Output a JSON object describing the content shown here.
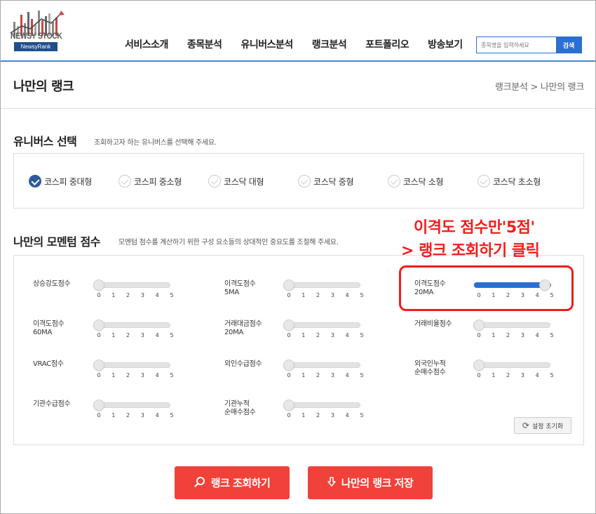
{
  "header": {
    "logo_text": "NEWSY STOCK",
    "logo_badge": "NewsyRank",
    "nav": [
      "서비스소개",
      "종목분석",
      "유니버스분석",
      "랭크분석",
      "포트폴리오",
      "방송보기"
    ],
    "search_placeholder": "종목명을 입력하세요",
    "search_button": "검색"
  },
  "page": {
    "title": "나만의 랭크",
    "breadcrumb": "랭크분석 > 나만의 랭크"
  },
  "universe": {
    "title": "유니버스 선택",
    "description": "조회하고자 하는 유니버스를 선택해 주세요.",
    "options": [
      {
        "label": "코스피 중대형",
        "checked": true
      },
      {
        "label": "코스피 중소형",
        "checked": false
      },
      {
        "label": "코스닥 대형",
        "checked": false
      },
      {
        "label": "코스닥 중형",
        "checked": false
      },
      {
        "label": "코스닥 소형",
        "checked": false
      },
      {
        "label": "코스닥 초소형",
        "checked": false
      }
    ]
  },
  "momentum": {
    "title": "나만의 모멘텀 점수",
    "description": "모멘텀 점수를 계산하기 위한 구성 요소들의 상대적인 중요도를 조절해 주세요.",
    "tick_labels": [
      "0",
      "1",
      "2",
      "3",
      "4",
      "5"
    ],
    "sliders": [
      {
        "label_lines": [
          "상승강도점수"
        ],
        "value": 0
      },
      {
        "label_lines": [
          "이격도점수",
          "5MA"
        ],
        "value": 0
      },
      {
        "label_lines": [
          "이격도점수",
          "20MA"
        ],
        "value": 5
      },
      {
        "label_lines": [
          "이격도점수",
          "60MA"
        ],
        "value": 0
      },
      {
        "label_lines": [
          "거래대금점수",
          "20MA"
        ],
        "value": 0
      },
      {
        "label_lines": [
          "거래비율점수"
        ],
        "value": 0
      },
      {
        "label_lines": [
          "VRAC점수"
        ],
        "value": 0
      },
      {
        "label_lines": [
          "외인수급점수"
        ],
        "value": 0
      },
      {
        "label_lines": [
          "외국인누적",
          "순매수점수"
        ],
        "value": 0
      },
      {
        "label_lines": [
          "기관수급점수"
        ],
        "value": 0
      },
      {
        "label_lines": [
          "기관누적",
          "순매수점수"
        ],
        "value": 0
      }
    ],
    "reset_label": "설정 초기화"
  },
  "annotation": {
    "line1": "이격도 점수만'5점'",
    "line2": "> 랭크 조회하기 클릭",
    "color": "#f31c1c"
  },
  "actions": {
    "query_label": "랭크 조회하기",
    "save_label": "나만의 랭크 저장"
  },
  "colors": {
    "accent": "#2a6fd1",
    "action": "#f2413a",
    "checked": "#2d5a9e"
  }
}
